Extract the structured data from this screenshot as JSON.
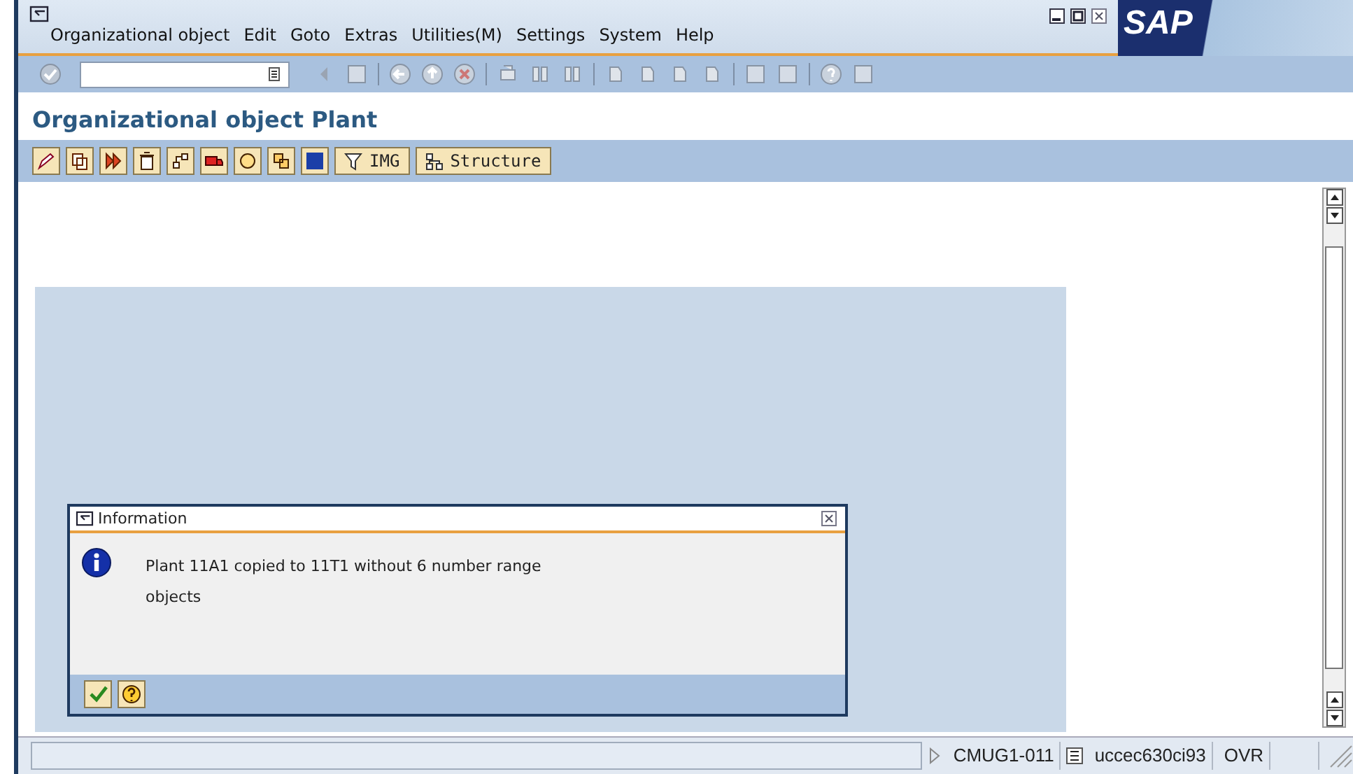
{
  "menu_bar": {
    "items": [
      {
        "label": "Organizational object"
      },
      {
        "label": "Edit"
      },
      {
        "label": "Goto"
      },
      {
        "label": "Extras"
      },
      {
        "label": "Utilities(M)"
      },
      {
        "label": "Settings"
      },
      {
        "label": "System"
      },
      {
        "label": "Help"
      }
    ],
    "logo": "SAP"
  },
  "screen_title": "Organizational object Plant",
  "app_toolbar": {
    "text_buttons": [
      {
        "label": "IMG",
        "kind": "filter"
      },
      {
        "label": "Structure",
        "kind": "structure"
      }
    ]
  },
  "dialog": {
    "title": "Information",
    "message": "Plant 11A1 copied to 11T1 without 6 number range objects"
  },
  "status_bar": {
    "system": "CMUG1-011",
    "server": "uccec630ci93",
    "mode": "OVR"
  }
}
